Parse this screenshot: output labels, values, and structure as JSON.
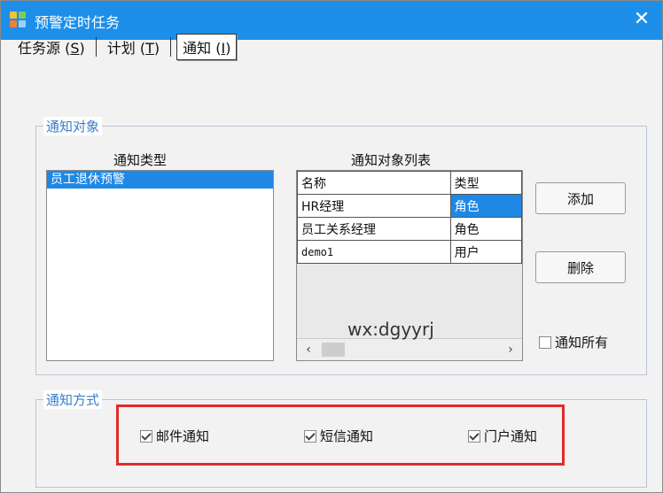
{
  "window": {
    "title": "预警定时任务",
    "close_label": "✕"
  },
  "tabs": [
    {
      "label": "任务源",
      "key": "S"
    },
    {
      "label": "计划",
      "key": "T"
    },
    {
      "label": "通知",
      "key": "I",
      "active": true
    }
  ],
  "notify_target": {
    "group_title": "通知对象",
    "type_label": "通知类型",
    "types": [
      "员工退休预警"
    ],
    "list_label": "通知对象列表",
    "columns": [
      "名称",
      "类型"
    ],
    "rows": [
      {
        "name": "HR经理",
        "type": "角色",
        "selected": true
      },
      {
        "name": "员工关系经理",
        "type": "角色"
      },
      {
        "name": "demo1",
        "type": "用户"
      }
    ],
    "add_label": "添加",
    "delete_label": "删除",
    "notify_all_label": "通知所有",
    "notify_all_checked": false
  },
  "watermark": "wx:dgyyrj",
  "notify_method": {
    "group_title": "通知方式",
    "options": [
      {
        "label": "邮件通知",
        "checked": true
      },
      {
        "label": "短信通知",
        "checked": true
      },
      {
        "label": "门户通知",
        "checked": true
      }
    ]
  },
  "colors": {
    "title_bar": "#1e8fe8",
    "selection": "#1e88e5",
    "group_title": "#3a7dc9",
    "highlight_box": "#e12b2b"
  }
}
